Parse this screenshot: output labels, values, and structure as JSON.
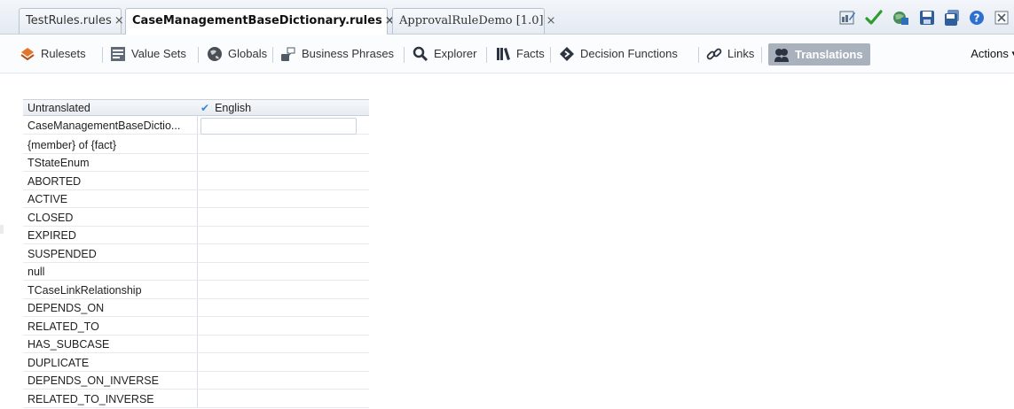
{
  "tabs": [
    {
      "label": "TestRules.rules",
      "close": "×",
      "active": false
    },
    {
      "label": "CaseManagementBaseDictionary.rules",
      "close": "×",
      "active": true
    },
    {
      "label": "ApprovalRuleDemo [1.0]",
      "close": "×",
      "active": false
    }
  ],
  "toolbar": {
    "items": [
      {
        "label": "Rulesets",
        "icon": "rulesets-icon"
      },
      {
        "label": "Value Sets",
        "icon": "value-sets-icon"
      },
      {
        "label": "Globals",
        "icon": "globe-icon"
      },
      {
        "label": "Business Phrases",
        "icon": "business-phrases-icon"
      },
      {
        "label": "Explorer",
        "icon": "search-icon"
      },
      {
        "label": "Facts",
        "icon": "facts-icon"
      },
      {
        "label": "Decision Functions",
        "icon": "decision-functions-icon"
      },
      {
        "label": "Links",
        "icon": "link-icon"
      },
      {
        "label": "Translations",
        "icon": "translations-icon",
        "selected": true
      }
    ],
    "actions_label": "Actions",
    "actions_arrow": "▾"
  },
  "top_icons": [
    "edit-icon",
    "validate-check-icon",
    "deploy-icon",
    "save-icon",
    "save-all-icon",
    "help-icon",
    "close-icon"
  ],
  "grid": {
    "headers": {
      "untranslated": "Untranslated",
      "english": "English",
      "check": "✔"
    },
    "rows": [
      "CaseManagementBaseDictio...",
      "{member} of {fact}",
      "TStateEnum",
      "ABORTED",
      "ACTIVE",
      "CLOSED",
      "EXPIRED",
      "SUSPENDED",
      "null",
      "TCaseLinkRelationship",
      "DEPENDS_ON",
      "RELATED_TO",
      "HAS_SUBCASE",
      "DUPLICATE",
      "DEPENDS_ON_INVERSE",
      "RELATED_TO_INVERSE"
    ],
    "english_value": ""
  },
  "colors": {
    "accent": "#3a86d6",
    "selected_tool_bg": "#a9b2bc",
    "validate_green": "#2e9c2e"
  }
}
